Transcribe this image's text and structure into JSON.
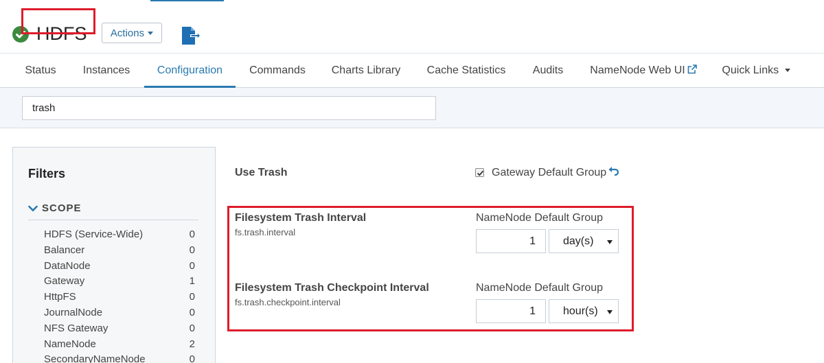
{
  "header": {
    "title": "HDFS",
    "status_icon": "check-circle-icon",
    "status_color": "#3b8a3e",
    "actions_label": "Actions",
    "export_icon": "export-file-icon"
  },
  "tabs": [
    {
      "label": "Status"
    },
    {
      "label": "Instances"
    },
    {
      "label": "Configuration",
      "active": true
    },
    {
      "label": "Commands"
    },
    {
      "label": "Charts Library"
    },
    {
      "label": "Cache Statistics"
    },
    {
      "label": "Audits"
    },
    {
      "label": "NameNode Web UI",
      "icon": "external-link-icon"
    },
    {
      "label": "Quick Links",
      "icon": "caret-down-icon"
    }
  ],
  "search": {
    "value": "trash"
  },
  "filters": {
    "title": "Filters",
    "scope_label": "SCOPE",
    "scope_items": [
      {
        "name": "HDFS (Service-Wide)",
        "count": "0"
      },
      {
        "name": "Balancer",
        "count": "0"
      },
      {
        "name": "DataNode",
        "count": "0"
      },
      {
        "name": "Gateway",
        "count": "1"
      },
      {
        "name": "HttpFS",
        "count": "0"
      },
      {
        "name": "JournalNode",
        "count": "0"
      },
      {
        "name": "NFS Gateway",
        "count": "0"
      },
      {
        "name": "NameNode",
        "count": "2"
      },
      {
        "name": "SecondaryNameNode",
        "count": "0"
      }
    ]
  },
  "config": {
    "use_trash": {
      "name": "Use Trash",
      "group": "Gateway Default Group",
      "checked": true
    },
    "trash_interval": {
      "name": "Filesystem Trash Interval",
      "key": "fs.trash.interval",
      "group": "NameNode Default Group",
      "value": "1",
      "unit": "day(s)"
    },
    "checkpoint_interval": {
      "name": "Filesystem Trash Checkpoint Interval",
      "key": "fs.trash.checkpoint.interval",
      "group": "NameNode Default Group",
      "value": "1",
      "unit": "hour(s)"
    }
  },
  "colors": {
    "accent": "#2a7ab0",
    "highlight": "#dd1c2b"
  }
}
